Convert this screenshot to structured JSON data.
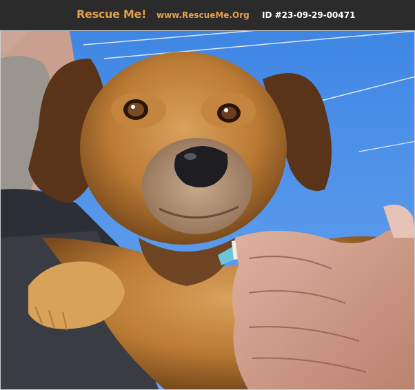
{
  "header": {
    "brand": "Rescue Me!",
    "site": "www.RescueMe.Org",
    "pet_id": "ID #23-09-29-00471",
    "brand_color": "#e3a04b",
    "background_color": "#2b2b2b"
  },
  "photo": {
    "subject": "dog-photo",
    "sky_color": "#4a8fe6"
  }
}
